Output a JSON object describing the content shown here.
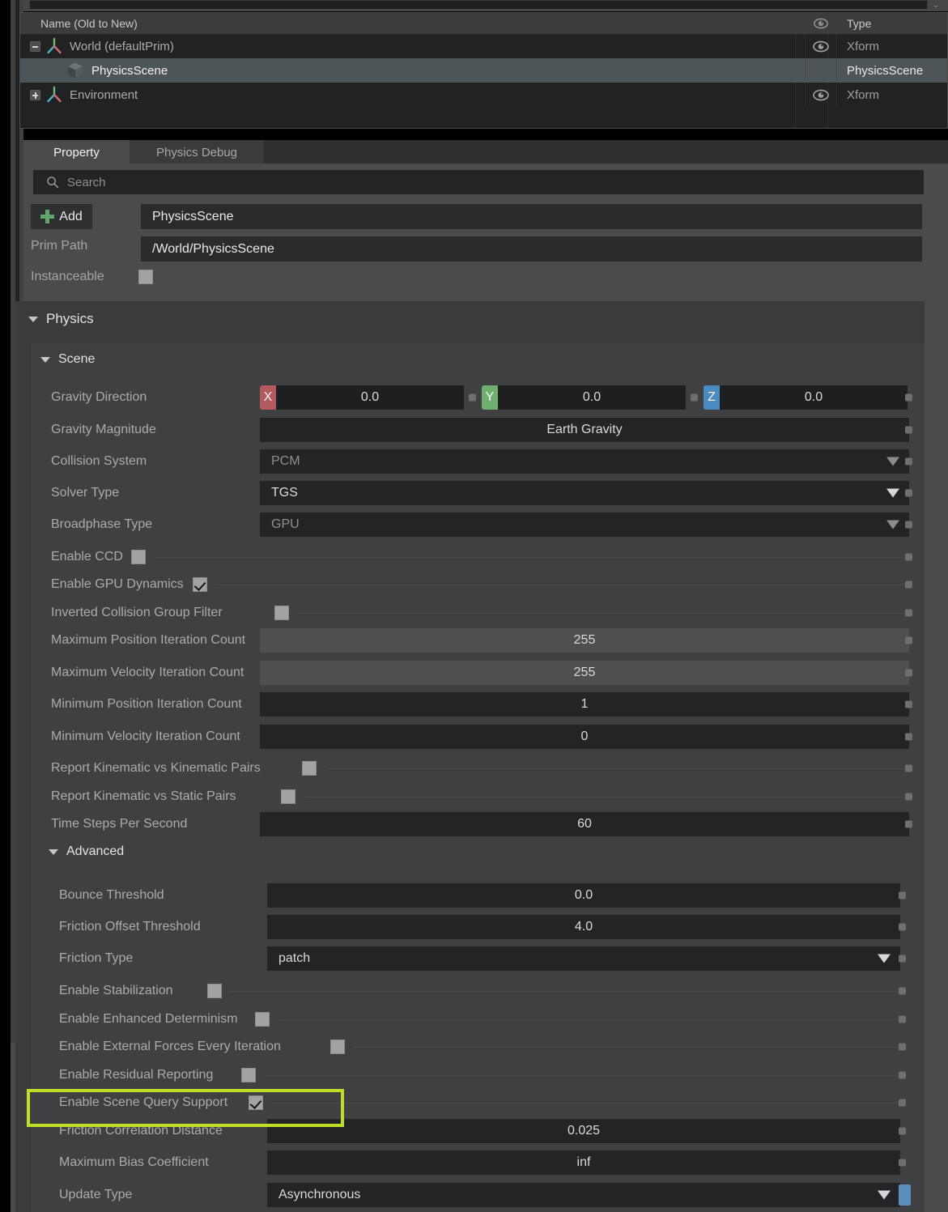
{
  "stage_tree": {
    "columns": {
      "name": "Name (Old to New)",
      "type": "Type",
      "visibility_icon": "eye-icon"
    },
    "rows": [
      {
        "label": "World (defaultPrim)",
        "type": "Xform",
        "icon": "xform-axis-icon",
        "expander": "minus",
        "indent": 0,
        "selected": false,
        "eye": true
      },
      {
        "label": "PhysicsScene",
        "type": "PhysicsScene",
        "icon": "cube-icon",
        "expander": "none",
        "indent": 1,
        "selected": true,
        "eye": false
      },
      {
        "label": "Environment",
        "type": "Xform",
        "icon": "xform-axis-icon",
        "expander": "plus",
        "indent": 0,
        "selected": false,
        "eye": true
      }
    ]
  },
  "tabs": [
    {
      "label": "Property",
      "active": true
    },
    {
      "label": "Physics Debug",
      "active": false
    }
  ],
  "property_panel": {
    "search_placeholder": "Search",
    "add_button": "Add",
    "prim_name_value": "PhysicsScene",
    "prim_path_label": "Prim Path",
    "prim_path_value": "/World/PhysicsScene",
    "instanceable_label": "Instanceable",
    "instanceable_checked": false,
    "physics_group": "Physics",
    "scene_group": "Scene",
    "advanced_group": "Advanced"
  },
  "scene_properties": [
    {
      "label": "Gravity Direction",
      "kind": "vec3",
      "x": "0.0",
      "y": "0.0",
      "z": "0.0"
    },
    {
      "label": "Gravity Magnitude",
      "kind": "text",
      "value": "Earth Gravity",
      "dim": false
    },
    {
      "label": "Collision System",
      "kind": "dropdown",
      "value": "PCM",
      "dim": true
    },
    {
      "label": "Solver Type",
      "kind": "dropdown",
      "value": "TGS",
      "dim": false
    },
    {
      "label": "Broadphase Type",
      "kind": "dropdown",
      "value": "GPU",
      "dim": true
    },
    {
      "label": "Enable CCD",
      "kind": "checkbox",
      "checked": false
    },
    {
      "label": "Enable GPU Dynamics",
      "kind": "checkbox",
      "checked": true
    },
    {
      "label": "Inverted Collision Group Filter",
      "kind": "checkbox",
      "checked": false
    },
    {
      "label": "Maximum Position Iteration Count",
      "kind": "number",
      "value": "255",
      "highlighted_field": true
    },
    {
      "label": "Maximum Velocity Iteration Count",
      "kind": "number",
      "value": "255",
      "highlighted_field": true
    },
    {
      "label": "Minimum Position Iteration Count",
      "kind": "number",
      "value": "1",
      "highlighted_field": false
    },
    {
      "label": "Minimum Velocity Iteration Count",
      "kind": "number",
      "value": "0",
      "highlighted_field": false
    },
    {
      "label": "Report Kinematic vs Kinematic Pairs",
      "kind": "checkbox",
      "checked": false
    },
    {
      "label": "Report Kinematic vs Static Pairs",
      "kind": "checkbox",
      "checked": false
    },
    {
      "label": "Time Steps Per Second",
      "kind": "number",
      "value": "60",
      "highlighted_field": false
    }
  ],
  "advanced_properties": [
    {
      "label": "Bounce Threshold",
      "kind": "number",
      "value": "0.0"
    },
    {
      "label": "Friction Offset Threshold",
      "kind": "number",
      "value": "4.0"
    },
    {
      "label": "Friction Type",
      "kind": "dropdown",
      "value": "patch"
    },
    {
      "label": "Enable Stabilization",
      "kind": "checkbox",
      "checked": false
    },
    {
      "label": "Enable Enhanced Determinism",
      "kind": "checkbox",
      "checked": false
    },
    {
      "label": "Enable External Forces Every Iteration",
      "kind": "checkbox",
      "checked": false
    },
    {
      "label": "Enable Residual Reporting",
      "kind": "checkbox",
      "checked": false
    },
    {
      "label": "Enable Scene Query Support",
      "kind": "checkbox",
      "checked": true,
      "highlighted": true
    },
    {
      "label": "Friction Correlation Distance",
      "kind": "number",
      "value": "0.025"
    },
    {
      "label": "Maximum Bias Coefficient",
      "kind": "number",
      "value": "inf"
    },
    {
      "label": "Update Type",
      "kind": "dropdown",
      "value": "Asynchronous",
      "blue_indicator": true
    }
  ],
  "colors": {
    "highlight": "#bddf26",
    "axis_x": "#b45a5e",
    "axis_y": "#6fb06f",
    "axis_z": "#4a8cc0",
    "add_plus": "#5fa668",
    "blue_indicator": "#5b8fbc"
  }
}
